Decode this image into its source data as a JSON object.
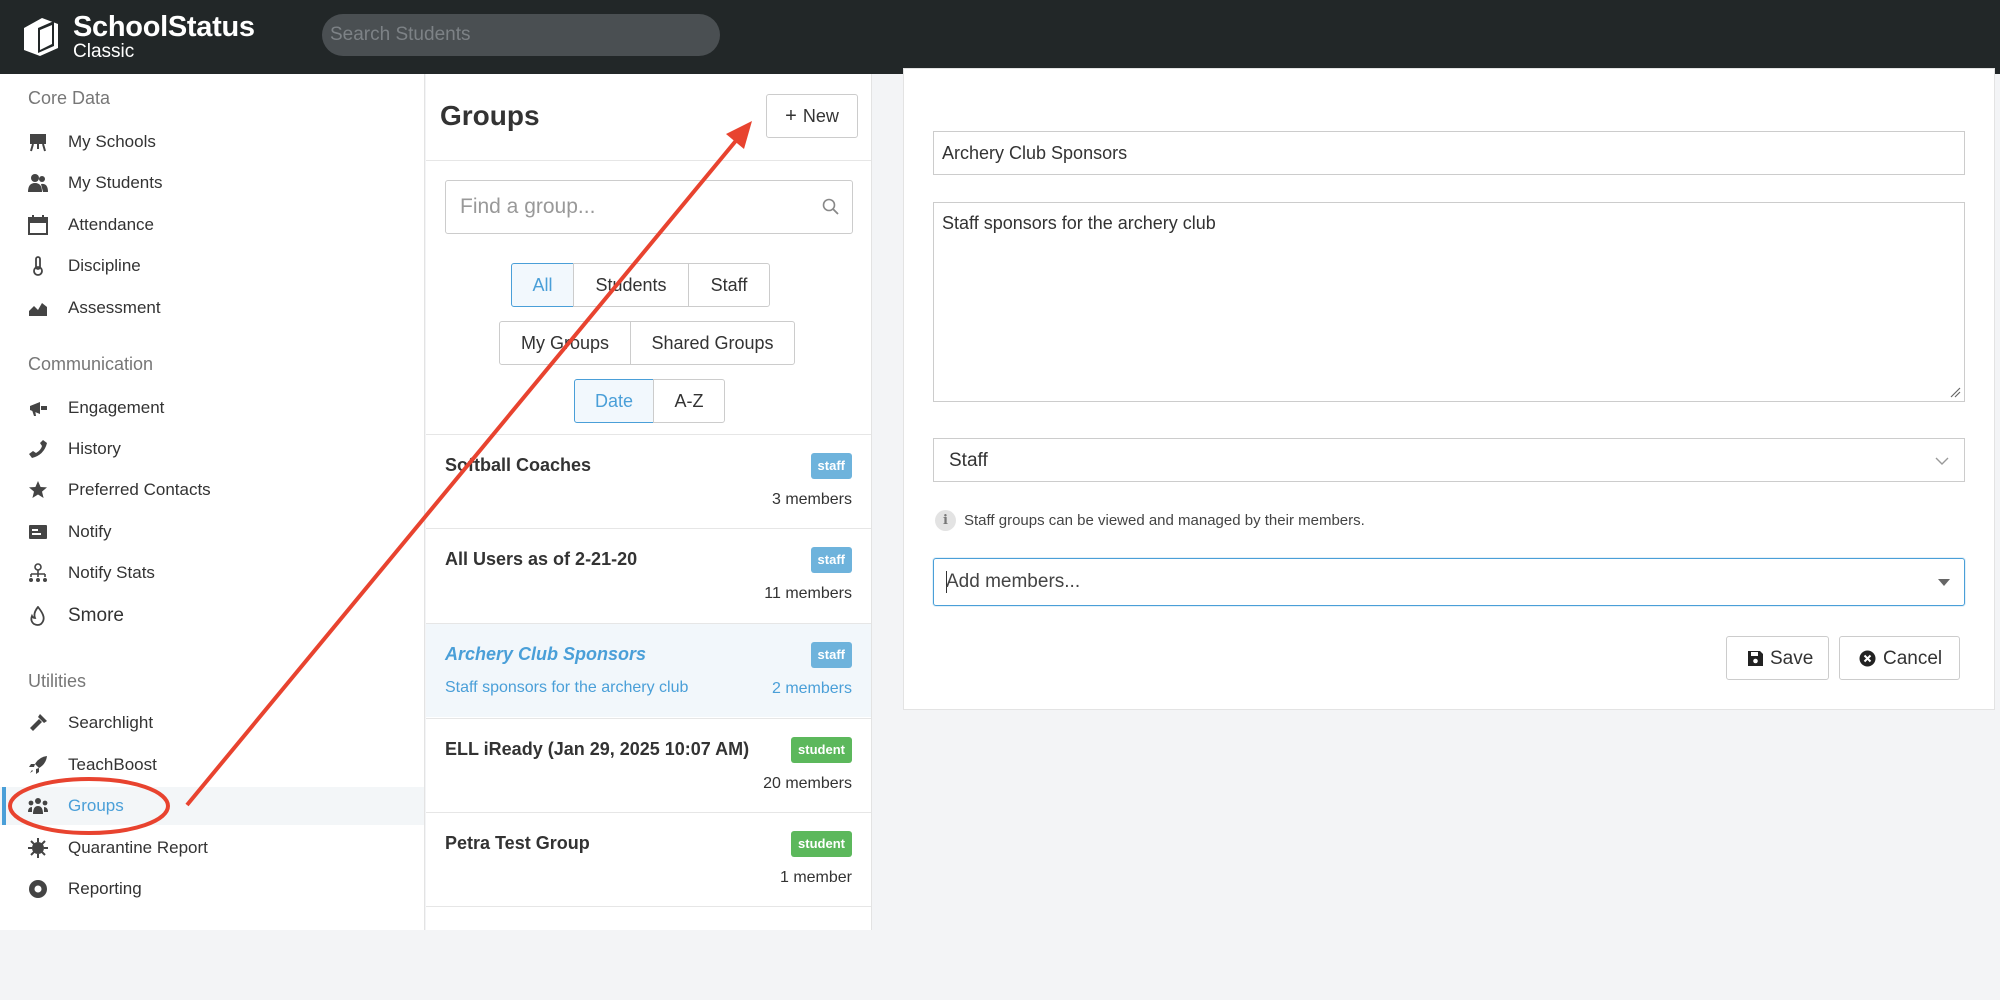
{
  "app": {
    "name": "SchoolStatus",
    "edition": "Classic",
    "search_placeholder": "Search Students"
  },
  "sidebar": {
    "sections": [
      {
        "title": "Core Data",
        "items": [
          {
            "label": "My Schools",
            "icon": "easel-icon"
          },
          {
            "label": "My Students",
            "icon": "users-icon"
          },
          {
            "label": "Attendance",
            "icon": "calendar-icon"
          },
          {
            "label": "Discipline",
            "icon": "thermometer-icon"
          },
          {
            "label": "Assessment",
            "icon": "area-chart-icon"
          }
        ]
      },
      {
        "title": "Communication",
        "items": [
          {
            "label": "Engagement",
            "icon": "megaphone-icon"
          },
          {
            "label": "History",
            "icon": "phone-icon"
          },
          {
            "label": "Preferred Contacts",
            "icon": "star-icon"
          },
          {
            "label": "Notify",
            "icon": "id-card-icon"
          },
          {
            "label": "Notify Stats",
            "icon": "sitemap-icon"
          },
          {
            "label": "Smore",
            "icon": "flame-icon"
          }
        ]
      },
      {
        "title": "Utilities",
        "items": [
          {
            "label": "Searchlight",
            "icon": "flashlight-icon"
          },
          {
            "label": "TeachBoost",
            "icon": "rocket-icon"
          },
          {
            "label": "Groups",
            "icon": "people-group-icon",
            "active": true
          },
          {
            "label": "Quarantine Report",
            "icon": "virus-icon"
          },
          {
            "label": "Reporting",
            "icon": "circle-dot-icon"
          }
        ]
      }
    ]
  },
  "groups": {
    "title": "Groups",
    "new_label": "New",
    "search_placeholder": "Find a group...",
    "filters": {
      "type": [
        "All",
        "Students",
        "Staff"
      ],
      "type_selected": "All",
      "ownership": [
        "My Groups",
        "Shared Groups"
      ],
      "sort": [
        "Date",
        "A-Z"
      ],
      "sort_selected": "Date"
    },
    "items": [
      {
        "name": "Softball Coaches",
        "badge": "staff",
        "description": "",
        "count": "3 members"
      },
      {
        "name": "All Users as of 2-21-20",
        "badge": "staff",
        "description": "",
        "count": "11 members"
      },
      {
        "name": "Archery Club Sponsors",
        "badge": "staff",
        "description": "Staff sponsors for the archery club",
        "count": "2 members",
        "selected": true
      },
      {
        "name": "ELL iReady (Jan 29, 2025 10:07 AM)",
        "badge": "student",
        "description": "",
        "count": "20 members"
      },
      {
        "name": "Petra Test Group",
        "badge": "student",
        "description": "",
        "count": "1 member"
      }
    ]
  },
  "editor": {
    "name_value": "Archery Club Sponsors",
    "description_value": "Staff sponsors for the archery club",
    "type_value": "Staff",
    "info_text": "Staff groups can be viewed and managed by their members.",
    "members_placeholder": "Add members...",
    "save_label": "Save",
    "cancel_label": "Cancel"
  },
  "colors": {
    "accent": "#4a9fd8",
    "topbar": "#222728",
    "badge_staff": "#6eb3dc",
    "badge_student": "#5cb85c",
    "annotation": "#e8432f"
  }
}
